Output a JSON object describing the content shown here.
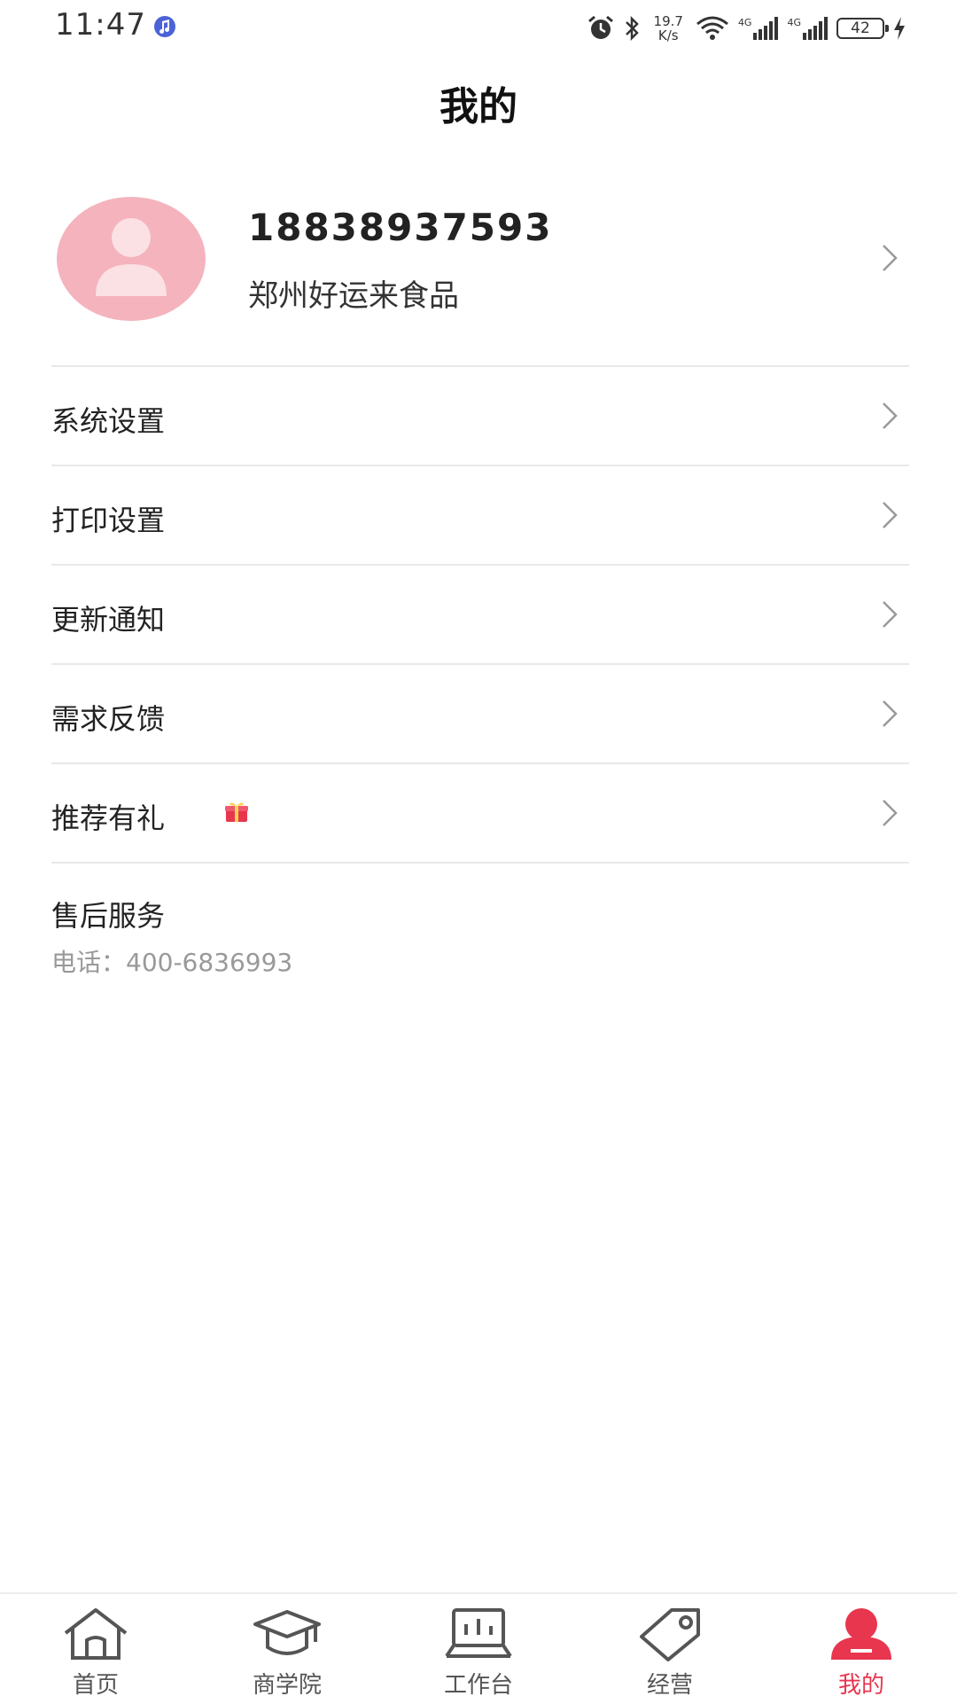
{
  "status_bar": {
    "time": "11:47",
    "net_speed_value": "19.7",
    "net_speed_unit": "K/s",
    "sim1_label": "4G",
    "sim2_label": "4G",
    "battery": "42"
  },
  "header": {
    "title": "我的"
  },
  "profile": {
    "phone": "18838937593",
    "company": "郑州好运来食品"
  },
  "menu": {
    "items": [
      {
        "label": "系统设置"
      },
      {
        "label": "打印设置"
      },
      {
        "label": "更新通知"
      },
      {
        "label": "需求反馈"
      },
      {
        "label": "推荐有礼"
      }
    ]
  },
  "after_sale": {
    "title": "售后服务",
    "phone": "电话：400-6836993"
  },
  "tab_bar": {
    "tabs": [
      {
        "label": "首页",
        "icon": "home-icon"
      },
      {
        "label": "商学院",
        "icon": "graduation-cap-icon"
      },
      {
        "label": "工作台",
        "icon": "workbench-icon"
      },
      {
        "label": "经营",
        "icon": "tag-icon"
      },
      {
        "label": "我的",
        "icon": "user-icon"
      }
    ],
    "active_index": 4
  },
  "colors": {
    "accent": "#e8364f",
    "avatar_bg": "#f4b3bd",
    "divider": "#e8e8e8",
    "secondary_text": "#999999"
  }
}
